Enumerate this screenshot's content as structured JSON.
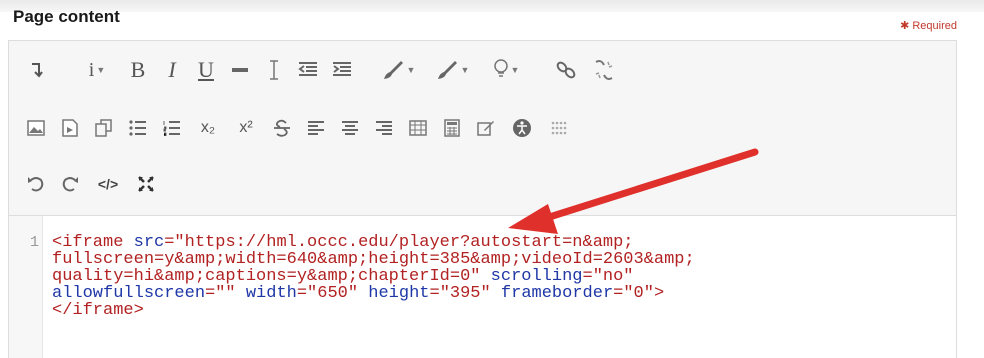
{
  "form": {
    "title": "Page content",
    "required_label": "✱ Required"
  },
  "toolbar": {
    "row1": [
      "collapse-icon",
      "info-icon",
      "bold-icon",
      "italic-icon",
      "underline-icon",
      "strikethrough-line-icon",
      "text-cursor-icon",
      "outdent-icon",
      "indent-icon",
      "brush-icon",
      "brush-alt-icon",
      "lightbulb-icon",
      "link-icon",
      "unlink-icon"
    ],
    "row2": [
      "image-icon",
      "media-icon",
      "copy-icon",
      "bullet-list-icon",
      "numbered-list-icon",
      "subscript-icon",
      "superscript-icon",
      "strikethrough-icon",
      "align-left-icon",
      "align-center-icon",
      "align-right-icon",
      "table-icon",
      "calculator-icon",
      "edit-icon",
      "accessibility-icon",
      "grid-icon"
    ],
    "row3": [
      "undo-icon",
      "redo-icon",
      "html-icon",
      "fullscreen-icon"
    ],
    "labels": {
      "bold": "B",
      "italic": "I",
      "underline": "U",
      "subscript": "x₂",
      "superscript": "x²",
      "html": "</>"
    }
  },
  "editor": {
    "line_number": "1",
    "lines": [
      [
        {
          "t": "tag",
          "v": "<iframe "
        },
        {
          "t": "attr",
          "v": "src"
        },
        {
          "t": "tag",
          "v": "=\"https://hml.occc.edu/player?autostart=n&amp;"
        }
      ],
      [
        {
          "t": "str",
          "v": "fullscreen=y&amp;width=640&amp;height=385&amp;videoId=2603&amp;"
        }
      ],
      [
        {
          "t": "str",
          "v": "quality=hi&amp;captions=y&amp;chapterId=0\" "
        },
        {
          "t": "attr",
          "v": "scrolling"
        },
        {
          "t": "str",
          "v": "=\"no\""
        }
      ],
      [
        {
          "t": "attr",
          "v": "allowfullscreen"
        },
        {
          "t": "str",
          "v": "=\"\" "
        },
        {
          "t": "attr",
          "v": "width"
        },
        {
          "t": "str",
          "v": "=\"650\" "
        },
        {
          "t": "attr",
          "v": "height"
        },
        {
          "t": "str",
          "v": "=\"395\" "
        },
        {
          "t": "attr",
          "v": "frameborder"
        },
        {
          "t": "str",
          "v": "=\"0\">"
        }
      ],
      [
        {
          "t": "tag",
          "v": "</iframe>"
        }
      ]
    ]
  },
  "colors": {
    "arrow": "#e0302b",
    "tag": "#b22222",
    "attr": "#1f37a7"
  }
}
